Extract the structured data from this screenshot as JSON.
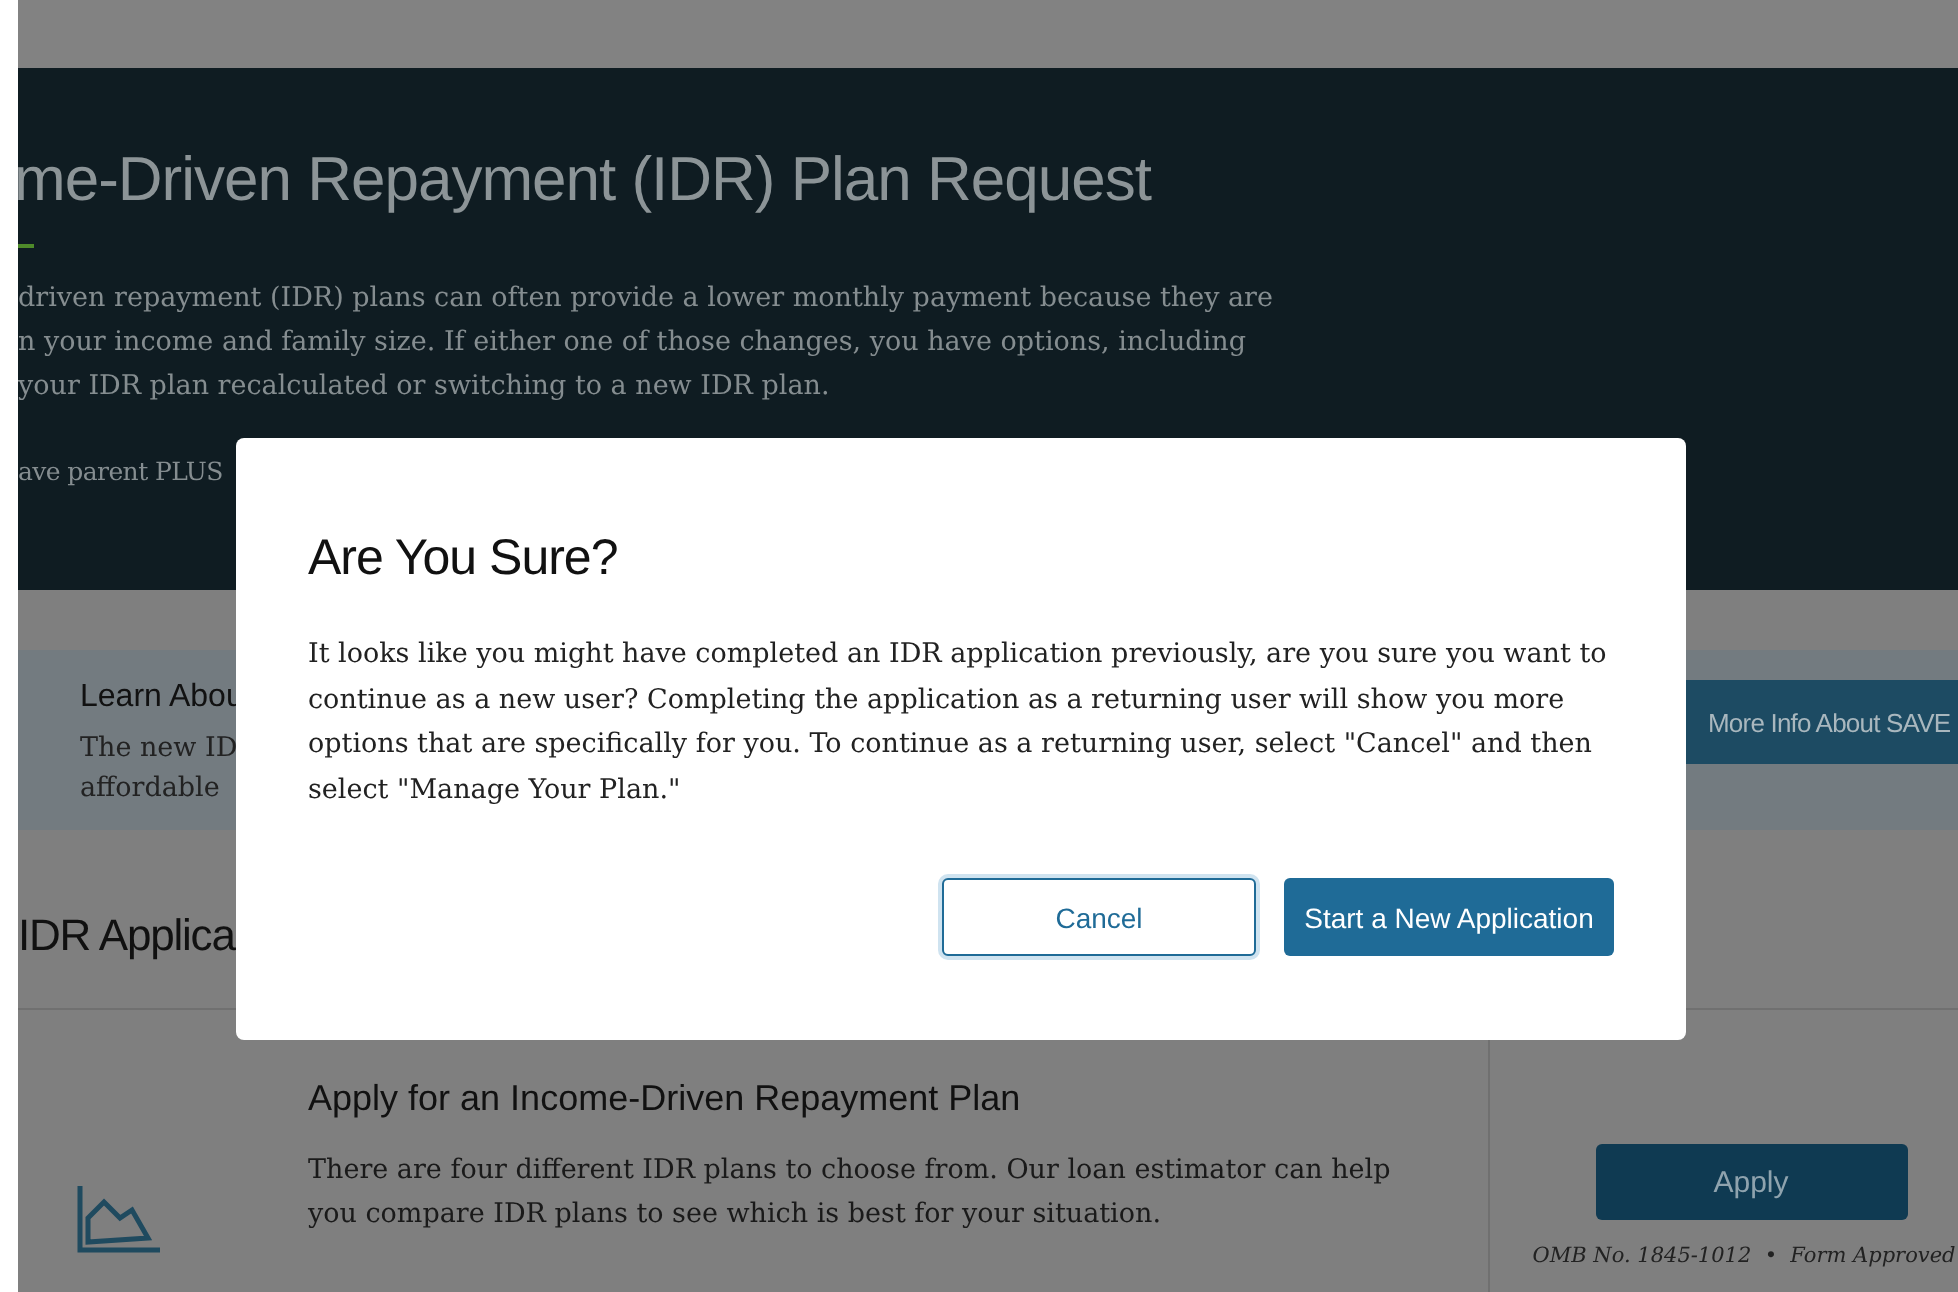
{
  "hero": {
    "title": "me-Driven Repayment (IDR) Plan Request",
    "lines": [
      "driven repayment (IDR) plans can often provide a lower monthly payment because they are",
      "n your income and family size. If either one of those changes, you have options, including",
      "your IDR plan recalculated or switching to a new IDR plan."
    ],
    "note": "ave parent PLUS"
  },
  "banner": {
    "title": "Learn Abou",
    "lines": [
      "The new ID",
      "affordable"
    ],
    "button": "More Info About SAVE"
  },
  "section_heading": "IDR Applica",
  "card": {
    "title": "Apply for an Income-Driven Repayment Plan",
    "text": "There are four different IDR plans to choose from. Our loan estimator can help you compare IDR plans to see which is best for your situation.",
    "button": "Apply",
    "omb": "OMB No. 1845-1012  •  Form Approved"
  },
  "dialog": {
    "title": "Are You Sure?",
    "text": "It looks like you might have completed an IDR application previously, are you sure you want to continue as a new user? Completing the application as a returning user will show you more options that are specifically for you. To continue as a returning user, select \"Cancel\" and then select \"Manage Your Plan.\"",
    "buttons": [
      {
        "label": "Cancel",
        "kind": "secondary"
      },
      {
        "label": "Start a New Application",
        "kind": "primary"
      }
    ]
  }
}
